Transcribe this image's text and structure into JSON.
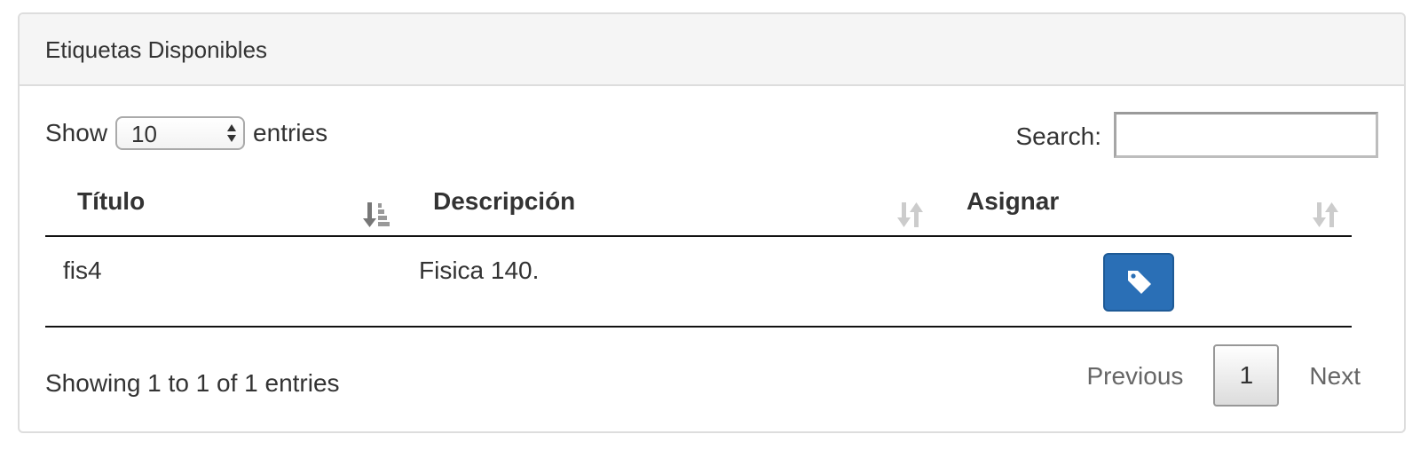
{
  "panel": {
    "title": "Etiquetas Disponibles"
  },
  "length_menu": {
    "prefix": "Show",
    "selected_value": "10",
    "suffix": "entries"
  },
  "search": {
    "label": "Search:",
    "value": ""
  },
  "table": {
    "columns": [
      {
        "label": "Título",
        "sort_state": "sorted-descending",
        "sort_icon": "sort-amount-desc-icon"
      },
      {
        "label": "Descripción",
        "sort_state": "unsorted",
        "sort_icon": "sort-both-icon"
      },
      {
        "label": "Asignar",
        "sort_state": "unsorted",
        "sort_icon": "sort-both-icon"
      }
    ],
    "rows": [
      {
        "titulo": "fis4",
        "descripcion": "Fisica 140.",
        "asignar_icon": "tag-icon"
      }
    ]
  },
  "info": {
    "text": "Showing 1 to 1 of 1 entries"
  },
  "pagination": {
    "previous_label": "Previous",
    "current_page": "1",
    "next_label": "Next"
  },
  "colors": {
    "panel_header_bg": "#f5f5f5",
    "border": "#dddddd",
    "primary_button": "#2a6fb6",
    "text": "#333333",
    "muted_text": "#666666"
  }
}
